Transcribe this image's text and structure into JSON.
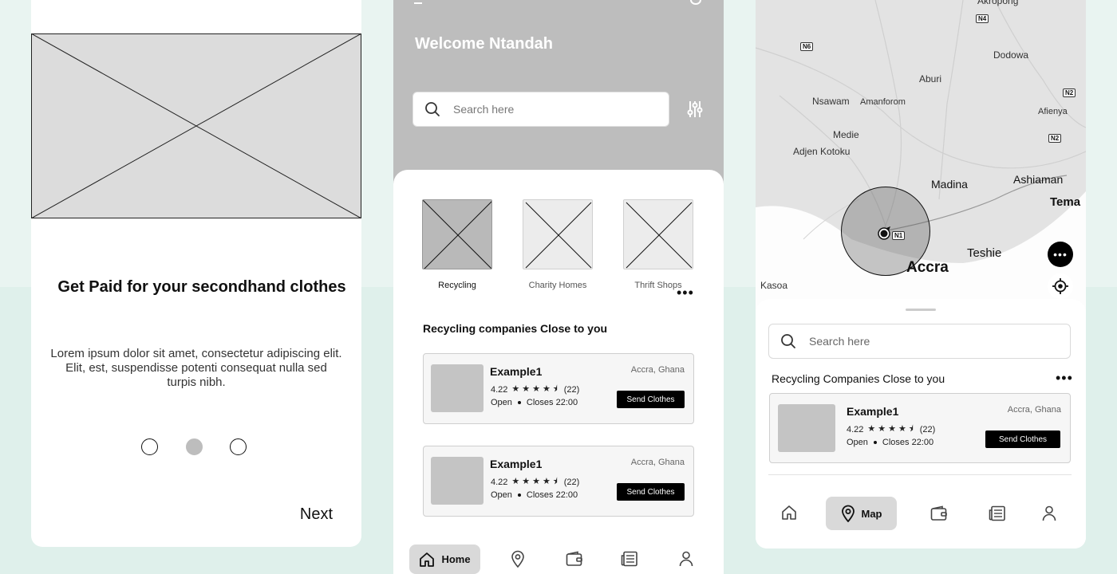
{
  "onboarding": {
    "title": "Get Paid for your secondhand clothes",
    "body": "Lorem ipsum dolor sit amet, consectetur adipiscing elit. Elit, est, suspendisse potenti consequat nulla sed turpis nibh.",
    "pager": {
      "count": 3,
      "active_index": 1
    },
    "next_label": "Next"
  },
  "home": {
    "welcome": "Welcome Ntandah",
    "search_placeholder": "Search here",
    "categories": [
      {
        "label": "Recycling",
        "active": true
      },
      {
        "label": "Charity Homes",
        "active": false
      },
      {
        "label": "Thrift Shops",
        "active": false
      }
    ],
    "section_title": "Recycling companies Close to you",
    "cards": [
      {
        "name": "Example1",
        "location": "Accra, Ghana",
        "rating": "4.22",
        "stars": 4.5,
        "reviews": "(22)",
        "status": "Open",
        "closes": "Closes 22:00",
        "action": "Send Clothes"
      },
      {
        "name": "Example1",
        "location": "Accra, Ghana",
        "rating": "4.22",
        "stars": 4.5,
        "reviews": "(22)",
        "status": "Open",
        "closes": "Closes 22:00",
        "action": "Send Clothes"
      }
    ],
    "nav": {
      "active": "Home",
      "active_label": "Home"
    }
  },
  "map_screen": {
    "map_labels": {
      "akropong": "Akropong",
      "dodowa": "Dodowa",
      "aburi": "Aburi",
      "nsawam": "Nsawam",
      "amanforom": "Amanforom",
      "afienya": "Afienya",
      "medie": "Medie",
      "adjen_kotoku": "Adjen Kotoku",
      "madina": "Madina",
      "ashiaman": "Ashiaman",
      "tema": "Tema",
      "teshie": "Teshie",
      "accra": "Accra",
      "kasoa": "Kasoa"
    },
    "road_shields": {
      "n4": "N4",
      "n6": "N6",
      "n2a": "N2",
      "n2b": "N2",
      "n1": "N1"
    },
    "search_placeholder": "Search here",
    "section_title": "Recycling Companies Close to you",
    "card": {
      "name": "Example1",
      "location": "Accra, Ghana",
      "rating": "4.22",
      "stars": 4.5,
      "reviews": "(22)",
      "status": "Open",
      "closes": "Closes 22:00",
      "action": "Send Clothes"
    },
    "nav": {
      "active": "Map",
      "active_label": "Map"
    }
  },
  "icons": [
    "search-icon",
    "filter-icon",
    "home-icon",
    "location-pin-icon",
    "wallet-icon",
    "news-icon",
    "profile-icon",
    "more-icon",
    "my-location-icon"
  ],
  "colors": {
    "background": "#e6f2ef",
    "placeholder_gray": "#bdbdbd",
    "button_black": "#000000"
  }
}
